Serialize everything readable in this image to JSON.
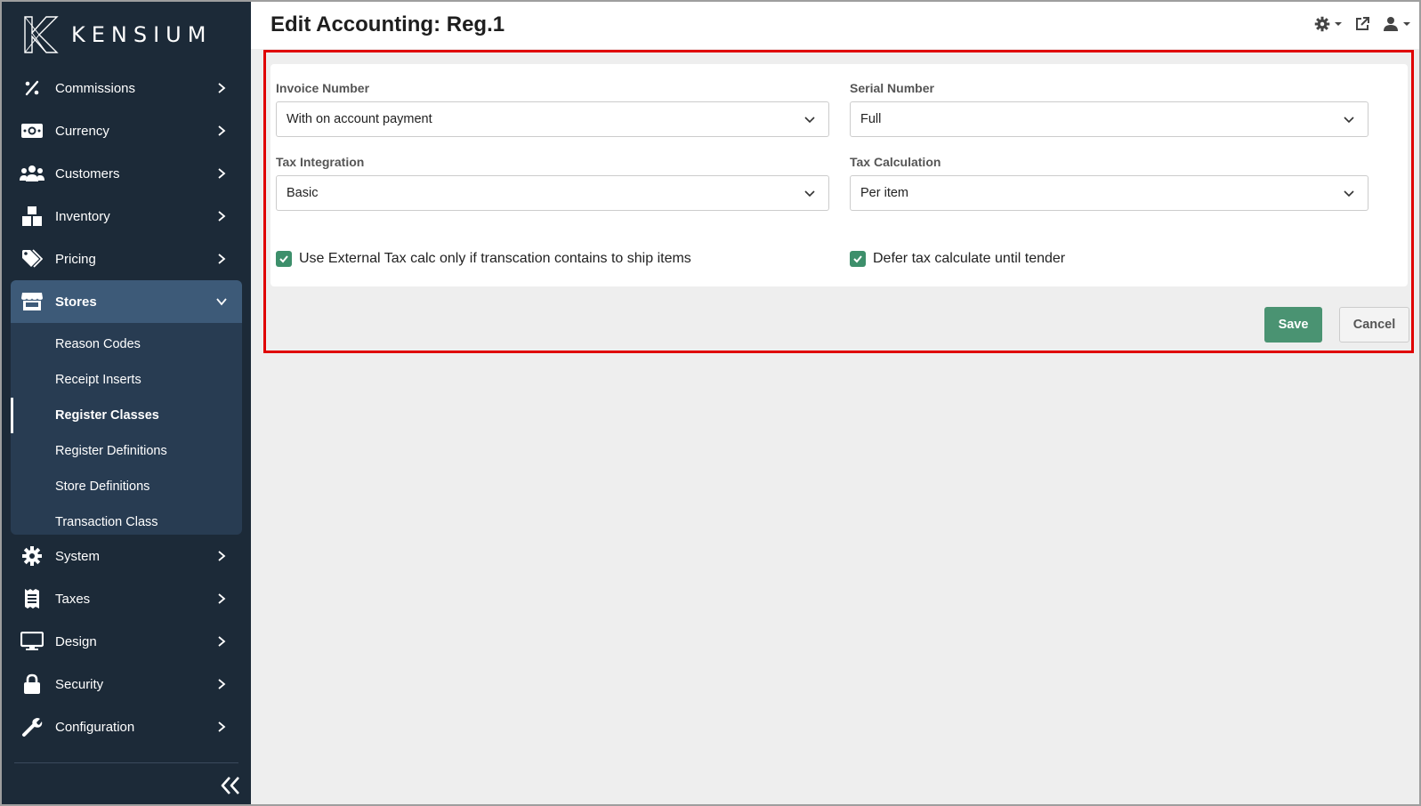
{
  "brand": {
    "name": "KENSIUM"
  },
  "header": {
    "title": "Edit Accounting: Reg.1",
    "icons": [
      "gear-icon",
      "external-link-icon",
      "user-icon"
    ]
  },
  "sidebar": {
    "items_top": [
      {
        "label": "Commissions",
        "icon": "percent-icon"
      },
      {
        "label": "Currency",
        "icon": "money-icon"
      },
      {
        "label": "Customers",
        "icon": "users-icon"
      },
      {
        "label": "Inventory",
        "icon": "boxes-icon"
      },
      {
        "label": "Pricing",
        "icon": "tags-icon"
      }
    ],
    "active": {
      "label": "Stores",
      "icon": "store-icon"
    },
    "sub_items": [
      {
        "label": "Reason Codes"
      },
      {
        "label": "Receipt Inserts"
      },
      {
        "label": "Register Classes"
      },
      {
        "label": "Register Definitions"
      },
      {
        "label": "Store Definitions"
      },
      {
        "label": "Transaction Class"
      }
    ],
    "items_bottom": [
      {
        "label": "System",
        "icon": "gear-icon"
      },
      {
        "label": "Taxes",
        "icon": "receipt-icon"
      },
      {
        "label": "Design",
        "icon": "monitor-icon"
      },
      {
        "label": "Security",
        "icon": "lock-icon"
      },
      {
        "label": "Configuration",
        "icon": "wrench-icon"
      }
    ]
  },
  "form": {
    "invoice_number": {
      "label": "Invoice Number",
      "value": "With on account payment"
    },
    "serial_number": {
      "label": "Serial Number",
      "value": "Full"
    },
    "tax_integration": {
      "label": "Tax Integration",
      "value": "Basic"
    },
    "tax_calculation": {
      "label": "Tax Calculation",
      "value": "Per item"
    },
    "external_tax_check": {
      "label": "Use External Tax calc only if transcation contains to ship items",
      "checked": true
    },
    "defer_tax_check": {
      "label": "Defer tax calculate until tender",
      "checked": true
    }
  },
  "actions": {
    "save_label": "Save",
    "cancel_label": "Cancel"
  },
  "colors": {
    "sidebar_bg": "#1c2a38",
    "active_bg": "#3d5a78",
    "save_green": "#4a9372",
    "highlight_red": "#e00000"
  }
}
